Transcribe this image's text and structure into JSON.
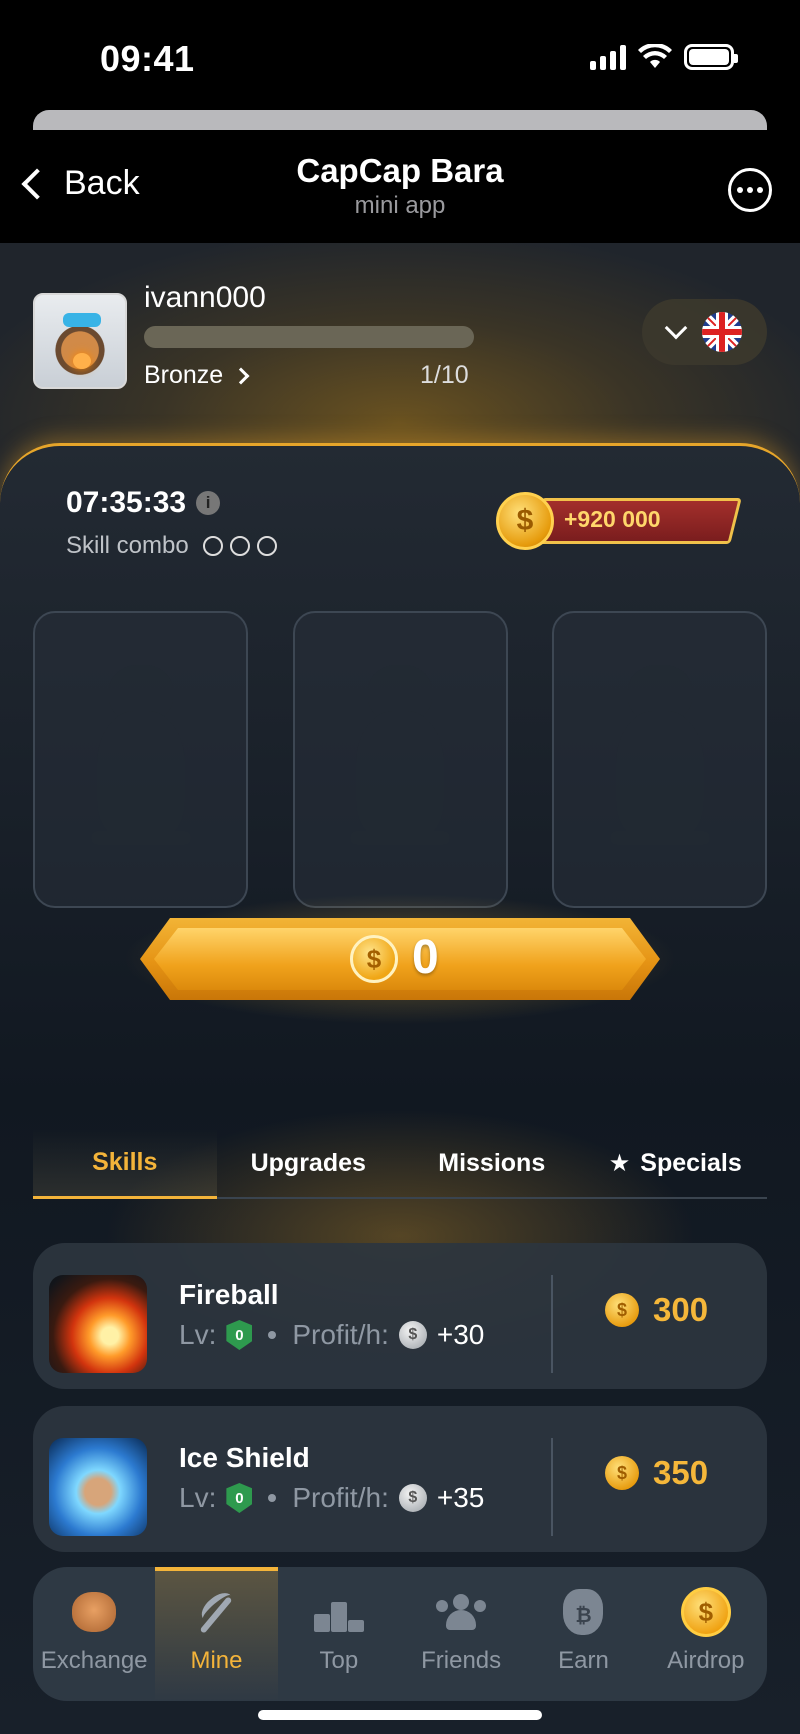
{
  "status_bar": {
    "time": "09:41"
  },
  "telegram_header": {
    "back_label": "Back",
    "title": "CapCap Bara",
    "subtitle": "mini app"
  },
  "profile": {
    "username": "ivann000",
    "rank": "Bronze",
    "rank_progress": "1/10",
    "progress_fraction": 0.1,
    "language_flag": "uk-flag-icon"
  },
  "combo": {
    "timer": "07:35:33",
    "label": "Skill combo",
    "reward": "+920 000",
    "slots_filled": 0,
    "slots_total": 3
  },
  "balance": {
    "value": "0"
  },
  "tabs": [
    {
      "label": "Skills",
      "active": true
    },
    {
      "label": "Upgrades",
      "active": false
    },
    {
      "label": "Missions",
      "active": false
    },
    {
      "label": "Specials",
      "active": false,
      "icon": "star-icon"
    }
  ],
  "skills": [
    {
      "name": "Fireball",
      "lv_label": "Lv:",
      "level": "0",
      "profit_label": "Profit/h:",
      "profit": "+30",
      "price": "300"
    },
    {
      "name": "Ice Shield",
      "lv_label": "Lv:",
      "level": "0",
      "profit_label": "Profit/h:",
      "profit": "+35",
      "price": "350"
    }
  ],
  "nav": [
    {
      "label": "Exchange",
      "icon": "capybara-icon",
      "active": false
    },
    {
      "label": "Mine",
      "icon": "pickaxe-icon",
      "active": true
    },
    {
      "label": "Top",
      "icon": "podium-icon",
      "active": false
    },
    {
      "label": "Friends",
      "icon": "friends-icon",
      "active": false
    },
    {
      "label": "Earn",
      "icon": "money-bag-icon",
      "active": false
    },
    {
      "label": "Airdrop",
      "icon": "gold-coin-icon",
      "active": false
    }
  ],
  "colors": {
    "accent": "#f4b43a",
    "background": "#1b2129",
    "card": "#2c353f",
    "reward_bar": "#a32f2b",
    "level_badge": "#2e9a4e"
  }
}
